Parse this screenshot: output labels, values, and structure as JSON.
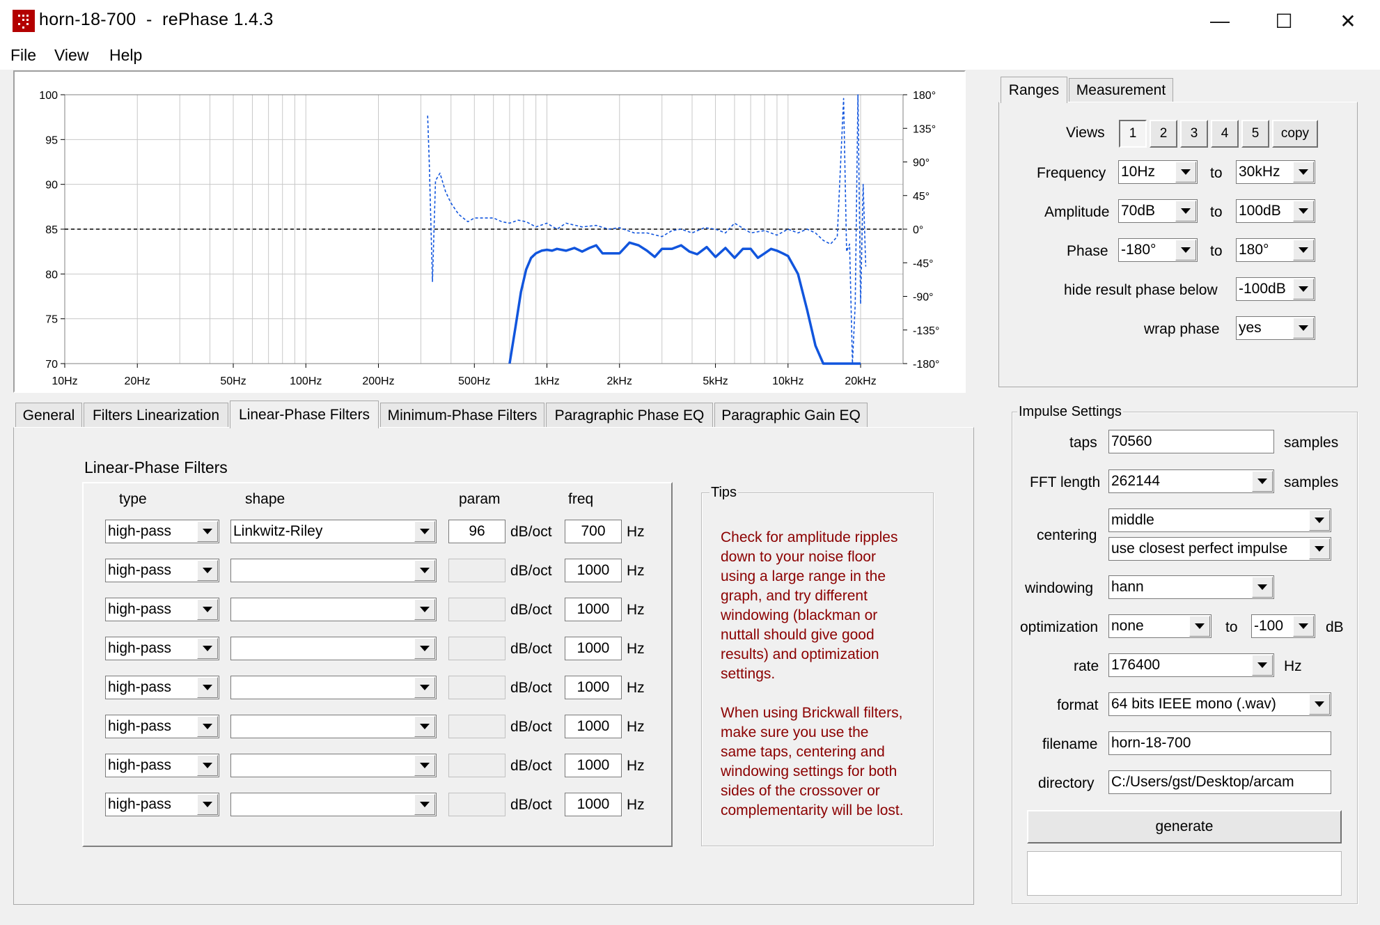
{
  "window": {
    "title": "horn-18-700  -  rePhase 1.4.3",
    "minimize_glyph": "—",
    "maximize_glyph": "☐",
    "close_glyph": "✕"
  },
  "menu": [
    "File",
    "View",
    "Help"
  ],
  "chart_data": {
    "type": "line",
    "xscale": "log",
    "xlim": [
      10,
      30000
    ],
    "ylim": [
      70,
      100
    ],
    "y2lim": [
      -180,
      180
    ],
    "grid": true,
    "x_ticks": [
      {
        "v": 10,
        "label": "10Hz"
      },
      {
        "v": 20,
        "label": "20Hz"
      },
      {
        "v": 50,
        "label": "50Hz"
      },
      {
        "v": 100,
        "label": "100Hz"
      },
      {
        "v": 200,
        "label": "200Hz"
      },
      {
        "v": 500,
        "label": "500Hz"
      },
      {
        "v": 1000,
        "label": "1kHz"
      },
      {
        "v": 2000,
        "label": "2kHz"
      },
      {
        "v": 5000,
        "label": "5kHz"
      },
      {
        "v": 10000,
        "label": "10kHz"
      },
      {
        "v": 20000,
        "label": "20kHz"
      }
    ],
    "y_ticks": [
      "100",
      "95",
      "90",
      "85",
      "80",
      "75",
      "70"
    ],
    "y2_ticks": [
      "180°",
      "135°",
      "90°",
      "45°",
      "0°",
      "-45°",
      "-90°",
      "-135°",
      "-180°"
    ],
    "reference_line_db": 85,
    "series": [
      {
        "style": "solid",
        "axis": "left",
        "color": "#1155dd",
        "x": [
          700,
          740,
          780,
          820,
          860,
          900,
          950,
          1000,
          1050,
          1100,
          1200,
          1300,
          1400,
          1500,
          1600,
          1700,
          1800,
          2000,
          2200,
          2400,
          2600,
          2800,
          3000,
          3300,
          3600,
          3900,
          4200,
          4600,
          5000,
          5500,
          6000,
          6500,
          7000,
          7500,
          8000,
          8500,
          9000,
          9500,
          10000,
          11000,
          12000,
          13000,
          14000,
          15000,
          16000,
          17000,
          18000,
          19000,
          20000
        ],
        "y": [
          70,
          74,
          78,
          80.5,
          81.8,
          82.3,
          82.6,
          82.7,
          82.6,
          82.8,
          82.6,
          82.9,
          82.5,
          82.9,
          83.2,
          82.3,
          82.3,
          82.3,
          83.5,
          83.2,
          82.6,
          81.9,
          82.8,
          82.8,
          83.2,
          82.5,
          82.2,
          83.0,
          81.9,
          82.9,
          81.8,
          82.8,
          82.8,
          81.8,
          82.3,
          82.8,
          82.6,
          82.3,
          82.0,
          80.0,
          76.0,
          72.0,
          70.0,
          70,
          70,
          70,
          70,
          70,
          70
        ]
      },
      {
        "style": "dashed",
        "axis": "right",
        "color": "#1155dd",
        "x": [
          320,
          325,
          335,
          345,
          360,
          380,
          400,
          430,
          470,
          500,
          550,
          600,
          650,
          700,
          760,
          820,
          900,
          1000,
          1100,
          1200,
          1400,
          1600,
          1800,
          2000,
          2300,
          2600,
          3000,
          3300,
          3600,
          4000,
          4500,
          5000,
          5500,
          6000,
          7000,
          8000,
          9000,
          10000,
          11000,
          12000,
          13000,
          14000,
          15000,
          16000,
          17000,
          17500,
          18000,
          18500,
          19000,
          19500,
          20000,
          20500,
          21000
        ],
        "y": [
          152,
          90,
          -70,
          65,
          75,
          50,
          35,
          20,
          10,
          15,
          15,
          15,
          10,
          8,
          12,
          10,
          3,
          8,
          0,
          8,
          3,
          5,
          0,
          2,
          -5,
          -5,
          -10,
          -2,
          0,
          -5,
          2,
          0,
          -5,
          8,
          -5,
          -2,
          -8,
          0,
          -5,
          0,
          -5,
          -15,
          -20,
          -10,
          175,
          -30,
          -20,
          -180,
          -100,
          180,
          -100,
          60,
          -50
        ]
      }
    ]
  },
  "tabs": [
    "General",
    "Filters Linearization",
    "Linear-Phase Filters",
    "Minimum-Phase Filters",
    "Paragraphic Phase EQ",
    "Paragraphic Gain EQ"
  ],
  "linear_phase": {
    "title": "Linear-Phase Filters",
    "headers": {
      "type": "type",
      "shape": "shape",
      "param": "param",
      "freq": "freq"
    },
    "rows": [
      {
        "type": "high-pass",
        "shape": "Linkwitz-Riley",
        "param": "96",
        "unit": "dB/oct",
        "freq": "700",
        "hz": "Hz",
        "param_enabled": true
      },
      {
        "type": "high-pass",
        "shape": "",
        "param": "",
        "unit": "dB/oct",
        "freq": "1000",
        "hz": "Hz",
        "param_enabled": false
      },
      {
        "type": "high-pass",
        "shape": "",
        "param": "",
        "unit": "dB/oct",
        "freq": "1000",
        "hz": "Hz",
        "param_enabled": false
      },
      {
        "type": "high-pass",
        "shape": "",
        "param": "",
        "unit": "dB/oct",
        "freq": "1000",
        "hz": "Hz",
        "param_enabled": false
      },
      {
        "type": "high-pass",
        "shape": "",
        "param": "",
        "unit": "dB/oct",
        "freq": "1000",
        "hz": "Hz",
        "param_enabled": false
      },
      {
        "type": "high-pass",
        "shape": "",
        "param": "",
        "unit": "dB/oct",
        "freq": "1000",
        "hz": "Hz",
        "param_enabled": false
      },
      {
        "type": "high-pass",
        "shape": "",
        "param": "",
        "unit": "dB/oct",
        "freq": "1000",
        "hz": "Hz",
        "param_enabled": false
      },
      {
        "type": "high-pass",
        "shape": "",
        "param": "",
        "unit": "dB/oct",
        "freq": "1000",
        "hz": "Hz",
        "param_enabled": false
      }
    ]
  },
  "tips": {
    "title": "Tips",
    "lines1": [
      "Check for amplitude ripples",
      "down to your noise floor",
      "using a large range in the",
      "graph, and try different",
      "windowing (blackman or",
      "nuttall should give good",
      "results) and optimization",
      "settings."
    ],
    "lines2": [
      "When using Brickwall filters,",
      "make sure you use the",
      "same taps, centering and",
      "windowing settings for both",
      "sides of the crossover or",
      "complementarity will be lost."
    ]
  },
  "ranges": {
    "tabs": [
      "Ranges",
      "Measurement"
    ],
    "views_label": "Views",
    "views_buttons": [
      "1",
      "2",
      "3",
      "4",
      "5",
      "copy"
    ],
    "frequency_label": "Frequency",
    "frequency_from": "10Hz",
    "frequency_to": "30kHz",
    "amplitude_label": "Amplitude",
    "amplitude_from": "70dB",
    "amplitude_to": "100dB",
    "phase_label": "Phase",
    "phase_from": "-180°",
    "phase_to": "180°",
    "to_label": "to",
    "hide_label": "hide result phase below",
    "hide_value": "-100dB",
    "wrap_label": "wrap phase",
    "wrap_value": "yes"
  },
  "impulse": {
    "title": "Impulse Settings",
    "taps_label": "taps",
    "taps": "70560",
    "samples": "samples",
    "fft_label": "FFT length",
    "fft": "262144",
    "centering_label": "centering",
    "centering": "middle",
    "centering2": "use closest perfect impulse",
    "windowing_label": "windowing",
    "windowing": "hann",
    "optimization_label": "optimization",
    "optimization": "none",
    "to": "to",
    "opt_to": "-100",
    "db": "dB",
    "rate_label": "rate",
    "rate": "176400",
    "hz": "Hz",
    "format_label": "format",
    "format": "64 bits IEEE mono (.wav)",
    "filename_label": "filename",
    "filename": "horn-18-700",
    "directory_label": "directory",
    "directory": "C:/Users/gst/Desktop/arcam",
    "generate": "generate",
    "status": ""
  }
}
